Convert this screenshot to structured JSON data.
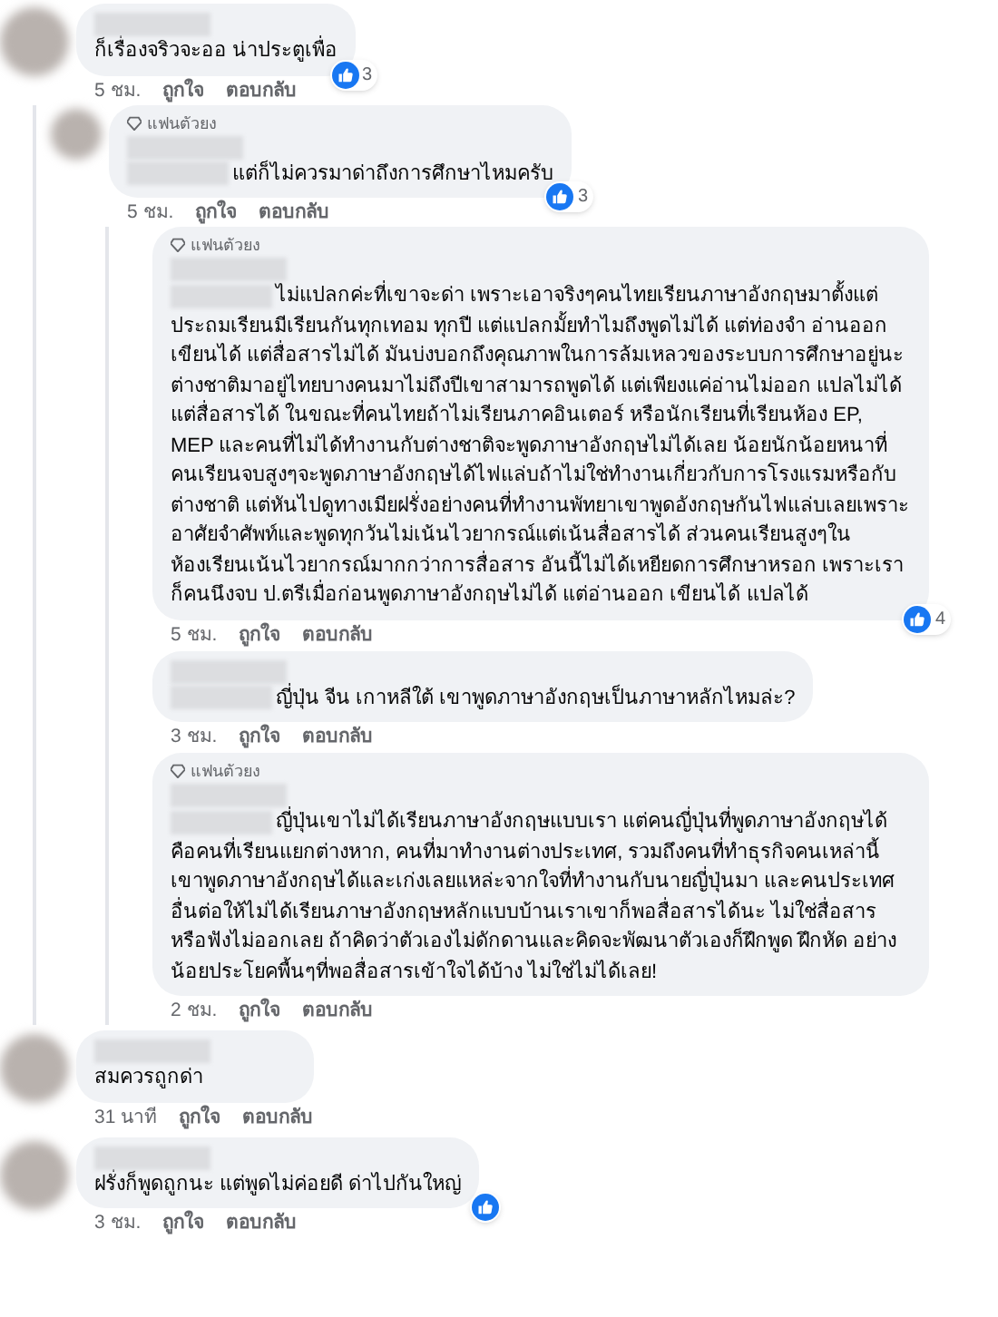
{
  "comments": [
    {
      "mention": false,
      "text": "ก็เรื่องจริวจะออ น่าประตูเพื่อ",
      "reaction": true,
      "like_count": "3",
      "time": "5 ชม.",
      "actions": [
        "ถูกใจ",
        "ตอบกลับ"
      ],
      "children": [
        {
          "badge": "แฟนตัวยง",
          "mention": true,
          "text": "แต่ก็ไม่ควรมาด่าถึงการศึกษาไหมครับ",
          "reaction": true,
          "like_count": "3",
          "time": "5 ชม.",
          "actions": [
            "ถูกใจ",
            "ตอบกลับ"
          ],
          "children": [
            {
              "badge": "แฟนตัวยง",
              "mention": true,
              "text": "ไม่แปลกค่ะที่เขาจะด่า เพราะเอาจริงๆคนไทยเรียนภาษาอังกฤษมาตั้งแต่ประถมเรียนมีเรียนกันทุกเทอม ทุกปี แต่แปลกมั้ยทำไมถึงพูดไม่ได้ แต่ท่องจำ อ่านออก เขียนได้ แต่สื่อสารไม่ได้ มันบ่งบอกถึงคุณภาพในการล้มเหลวของระบบการศึกษาอยู่นะ ต่างชาติมาอยู่ไทยบางคนมาไม่ถึงปีเขาสามารถพูดได้ แต่เพียงแค่อ่านไม่ออก แปลไม่ได้แต่สื่อสารได้ ในขณะที่คนไทยถ้าไม่เรียนภาคอินเตอร์ หรือนักเรียนที่เรียนห้อง EP, MEP และคนที่ไม่ได้ทำงานกับต่างชาติจะพูดภาษาอังกฤษไม่ได้เลย น้อยนักน้อยหนาที่คนเรียนจบสูงๆจะพูดภาษาอังกฤษได้ไฟแล่บถ้าไม่ใช่ทำงานเกี่ยวกับการโรงแรมหรือกับต่างชาติ แต่หันไปดูทางเมียฝรั่งอย่างคนที่ทำงานพัทยาเขาพูดอังกฤษกันไฟแล่บเลยเพราะอาศัยจำศัพท์และพูดทุกวันไม่เน้นไวยากรณ์แต่เน้นสื่อสารได้ ส่วนคนเรียนสูงๆในห้องเรียนเน้นไวยากรณ์มากกว่าการสื่อสาร อันนี้ไม่ได้เหยียดการศึกษาหรอก เพราะเราก็คนนึงจบ ป.ตรีเมื่อก่อนพูดภาษาอังกฤษไม่ได้ แต่อ่านออก เขียนได้ แปลได้",
              "reaction": true,
              "like_count": "4",
              "time": "5 ชม.",
              "actions": [
                "ถูกใจ",
                "ตอบกลับ"
              ]
            },
            {
              "mention": true,
              "text": "ญี่ปุ่น จีน เกาหลีใต้ เขาพูดภาษาอังกฤษเป็นภาษาหลักไหมล่ะ?",
              "reaction": false,
              "time": "3 ชม.",
              "actions": [
                "ถูกใจ",
                "ตอบกลับ"
              ]
            },
            {
              "badge": "แฟนตัวยง",
              "mention": true,
              "text": "ญี่ปุ่นเขาไม่ได้เรียนภาษาอังกฤษแบบเรา แต่คนญี่ปุ่นที่พูดภาษาอังกฤษได้คือคนที่เรียนแยกต่างหาก, คนที่มาทำงานต่างประเทศ, รวมถึงคนที่ทำธุรกิจคนเหล่านี้เขาพูดภาษาอังกฤษได้และเก่งเลยแหล่ะจากใจที่ทำงานกับนายญี่ปุ่นมา และคนประเทศอื่นต่อให้ไม่ได้เรียนภาษาอังกฤษหลักแบบบ้านเราเขาก็พอสื่อสารได้นะ ไม่ใช่สื่อสารหรือฟังไม่ออกเลย ถ้าคิดว่าตัวเองไม่ดักดานและคิดจะพัฒนาตัวเองก็ฝึกพูด ฝึกหัด อย่างน้อยประโยคพื้นๆที่พอสื่อสารเข้าใจได้บ้าง ไม่ใช่ไม่ได้เลย!",
              "reaction": false,
              "time": "2 ชม.",
              "actions": [
                "ถูกใจ",
                "ตอบกลับ"
              ]
            }
          ]
        }
      ]
    },
    {
      "mention": false,
      "text": "สมควรถูกด่า",
      "reaction": false,
      "time": "31 นาที",
      "actions": [
        "ถูกใจ",
        "ตอบกลับ"
      ]
    },
    {
      "mention": false,
      "text": "ฝรั่งก็พูดถูกนะ แต่พูดไม่ค่อยดี ด่าไปกันใหญ่",
      "reaction": true,
      "time": "3 ชม.",
      "actions": [
        "ถูกใจ",
        "ตอบกลับ"
      ]
    }
  ]
}
